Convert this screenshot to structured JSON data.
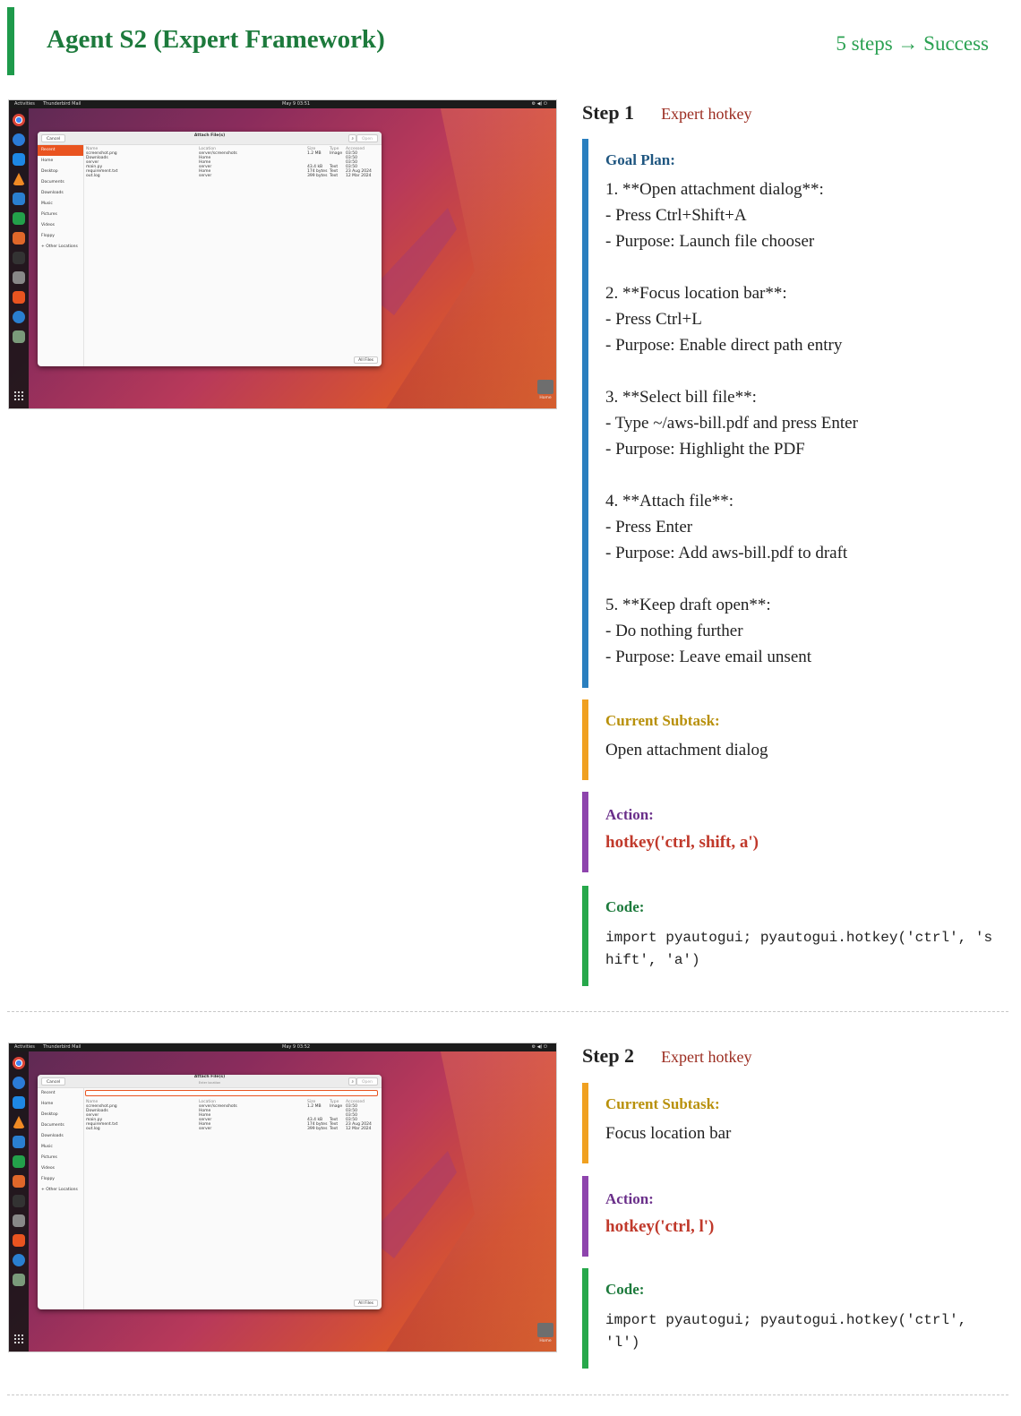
{
  "header": {
    "title": "Agent S2 (Expert Framework)",
    "summary": "5 steps → Success"
  },
  "steps": [
    {
      "step_label": "Step 1",
      "kind": "Expert hotkey",
      "goal_plan_label": "Goal Plan:",
      "goal_plan": "1. **Open attachment dialog**:\n- Press Ctrl+Shift+A\n- Purpose: Launch file chooser\n\n2. **Focus location bar**:\n- Press Ctrl+L\n- Purpose: Enable direct path entry\n\n3. **Select bill file**:\n- Type ~/aws-bill.pdf and press Enter\n- Purpose: Highlight the PDF\n\n4. **Attach file**:\n- Press Enter\n- Purpose: Add aws-bill.pdf to draft\n\n5. **Keep draft open**:\n- Do nothing further\n- Purpose: Leave email unsent",
      "subtask_label": "Current Subtask:",
      "subtask": "Open attachment dialog",
      "action_label": "Action:",
      "action": "hotkey('ctrl, shift, a')",
      "code_label": "Code:",
      "code": "import pyautogui; pyautogui.hotkey('ctrl', 'shift', 'a')",
      "screenshot": {
        "topbar_activities": "Activities",
        "topbar_app": "Thunderbird Mail",
        "topbar_clock": "May 9 03:51",
        "dialog_title": "Attach File(s)",
        "dialog_subtitle": "",
        "cancel": "Cancel",
        "open": "Open",
        "all_files": "All Files",
        "home_label": "Home"
      }
    },
    {
      "step_label": "Step 2",
      "kind": "Expert hotkey",
      "subtask_label": "Current Subtask:",
      "subtask": "Focus location bar",
      "action_label": "Action:",
      "action": "hotkey('ctrl, l')",
      "code_label": "Code:",
      "code": "import pyautogui; pyautogui.hotkey('ctrl', 'l')",
      "screenshot": {
        "topbar_activities": "Activities",
        "topbar_app": "Thunderbird Mail",
        "topbar_clock": "May 9 03:52",
        "dialog_title": "Attach File(s)",
        "dialog_subtitle": "Enter location",
        "cancel": "Cancel",
        "open": "Open",
        "all_files": "All Files",
        "home_label": "Home"
      }
    }
  ],
  "sidebar_places": [
    "Recent",
    "Home",
    "Desktop",
    "Documents",
    "Downloads",
    "Music",
    "Pictures",
    "Videos",
    "Floppy",
    "+ Other Locations"
  ],
  "file_columns": [
    "Name",
    "Location",
    "Size",
    "Type",
    "Accessed"
  ],
  "file_rows": [
    [
      "screenshot.png",
      "server/screenshots",
      "1.2 MB",
      "Image",
      "03:50"
    ],
    [
      "Downloads",
      "Home",
      "",
      "",
      "03:50"
    ],
    [
      "server",
      "Home",
      "",
      "",
      "03:50"
    ],
    [
      "main.py",
      "server",
      "43.4 kB",
      "Text",
      "03:50"
    ],
    [
      "requirement.txt",
      "Home",
      "174 bytes",
      "Text",
      "23 Aug 2024"
    ],
    [
      "out.log",
      "server",
      "399 bytes",
      "Text",
      "12 Mar 2024"
    ]
  ],
  "colors": {
    "header_accent": "#1e9a4b",
    "goal_plan_bar": "#2a7fbf",
    "subtask_bar": "#f0a020",
    "action_bar": "#8e44ad",
    "code_bar": "#27a84b",
    "action_text": "#c0392b"
  }
}
